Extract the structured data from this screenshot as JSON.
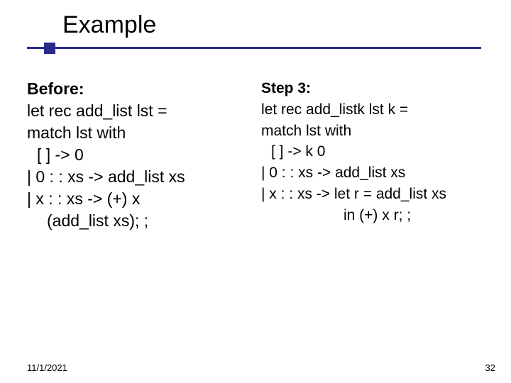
{
  "title": "Example",
  "left": {
    "heading": "Before:",
    "l1": "let rec add_list lst =",
    "l2": "match lst with",
    "l3": "[ ] -> 0",
    "l4": "| 0 : : xs -> add_list xs",
    "l5": "| x : : xs -> (+) x",
    "l6": "(add_list xs); ;"
  },
  "right": {
    "heading": "Step 3:",
    "l1": "let rec add_listk lst k =",
    "l2": "match lst with",
    "l3": "[ ] -> k 0",
    "l4": "| 0 : : xs -> add_list xs",
    "l5": "| x : : xs -> let r = add_list xs",
    "l6": "in (+) x r; ;"
  },
  "footer": {
    "date": "11/1/2021",
    "page": "32"
  }
}
